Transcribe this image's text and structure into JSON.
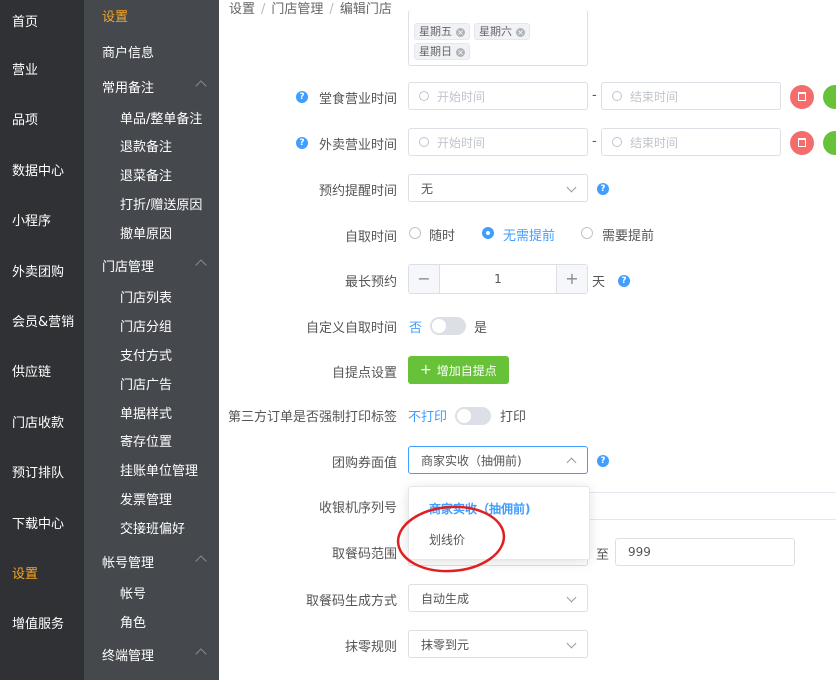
{
  "rail": {
    "items": [
      {
        "label": "首页"
      },
      {
        "label": "营业"
      },
      {
        "label": "品项"
      },
      {
        "label": "数据中心"
      },
      {
        "label": "小程序"
      },
      {
        "label": "外卖团购"
      },
      {
        "label": "会员&营销"
      },
      {
        "label": "供应链"
      },
      {
        "label": "门店收款"
      },
      {
        "label": "预订排队"
      },
      {
        "label": "下载中心"
      },
      {
        "label": "设置"
      },
      {
        "label": "增值服务"
      }
    ],
    "active_color": "#f5a623"
  },
  "submenu": {
    "title": "设置",
    "merchant_info": "商户信息",
    "common_notes": {
      "label": "常用备注",
      "items": [
        "单品/整单备注",
        "退款备注",
        "退菜备注",
        "打折/赠送原因",
        "撤单原因"
      ]
    },
    "store_mgmt": {
      "label": "门店管理",
      "items": [
        "门店列表",
        "门店分组",
        "支付方式",
        "门店广告",
        "单据样式",
        "寄存位置",
        "挂账单位管理",
        "发票管理",
        "交接班偏好"
      ]
    },
    "account_mgmt": {
      "label": "帐号管理",
      "items": [
        "帐号",
        "角色"
      ]
    },
    "terminal_mgmt": {
      "label": "终端管理"
    }
  },
  "breadcrumb": [
    "设置",
    "门店管理",
    "编辑门店"
  ],
  "form": {
    "weekday_tags": [
      "星期五",
      "星期六",
      "星期日"
    ],
    "dine_in_hours": {
      "label": "堂食营业时间",
      "start_placeholder": "开始时间",
      "end_placeholder": "结束时间"
    },
    "delivery_hours": {
      "label": "外卖营业时间",
      "start_placeholder": "开始时间",
      "end_placeholder": "结束时间"
    },
    "dash": "-",
    "reservation_reminder": {
      "label": "预约提醒时间",
      "value": "无"
    },
    "pickup_time": {
      "label": "自取时间",
      "options": [
        "随时",
        "无需提前",
        "需要提前"
      ],
      "selected": "无需提前"
    },
    "max_reservation": {
      "label": "最长预约",
      "value": "1",
      "unit": "天",
      "minus": "−",
      "plus": "+"
    },
    "custom_pickup": {
      "label": "自定义自取时间",
      "off_text": "否",
      "on_text": "是"
    },
    "pickup_point": {
      "label": "自提点设置",
      "button": "增加自提点"
    },
    "third_party_print": {
      "label": "第三方订单是否强制打印标签",
      "off_text": "不打印",
      "on_text": "打印"
    },
    "coupon_value": {
      "label": "团购券面值",
      "value": "商家实收（抽佣前)"
    },
    "cashier_serial": {
      "label": "收银机序列号"
    },
    "pickup_code_range": {
      "label": "取餐码范围",
      "to": "至",
      "max": "999"
    },
    "pickup_code_mode": {
      "label": "取餐码生成方式",
      "value": "自动生成"
    },
    "rounding": {
      "label": "抹零规则",
      "value": "抹零到元"
    }
  },
  "dropdown": {
    "options": [
      "商家实收（抽佣前)",
      "划线价"
    ],
    "selected": "商家实收（抽佣前)"
  },
  "colors": {
    "primary": "#409eff",
    "success": "#67c23a",
    "danger": "#f56c6c",
    "annotation": "#e02020"
  }
}
